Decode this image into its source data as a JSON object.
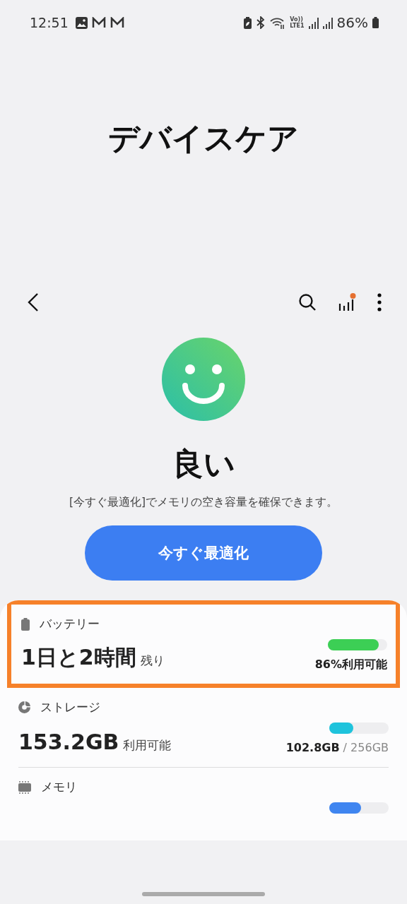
{
  "status_bar": {
    "time": "12:51",
    "volte": [
      "Vo))",
      "LTE1"
    ],
    "battery": "86%"
  },
  "title": "デバイスケア",
  "toolbar": {
    "stats_badge": true
  },
  "status": {
    "label": "良い",
    "message": "[今すぐ最適化]でメモリの空き容量を確保できます。",
    "button": "今すぐ最適化"
  },
  "items": [
    {
      "kind": "battery",
      "label": "バッテリー",
      "value": "1日と2時間",
      "unit": "残り",
      "level": 0.86,
      "color": "#3ccf55",
      "reading": "86%利用可能",
      "highlighted": true
    },
    {
      "kind": "storage",
      "label": "ストレージ",
      "value": "153.2GB",
      "unit": "利用可能",
      "level": 0.4,
      "color": "#1ec3dc",
      "reading": "102.8GB",
      "total": "/ 256GB",
      "highlighted": false
    },
    {
      "kind": "memory",
      "label": "メモリ",
      "level": 0.53,
      "color": "#3f85f0",
      "highlighted": false
    }
  ]
}
